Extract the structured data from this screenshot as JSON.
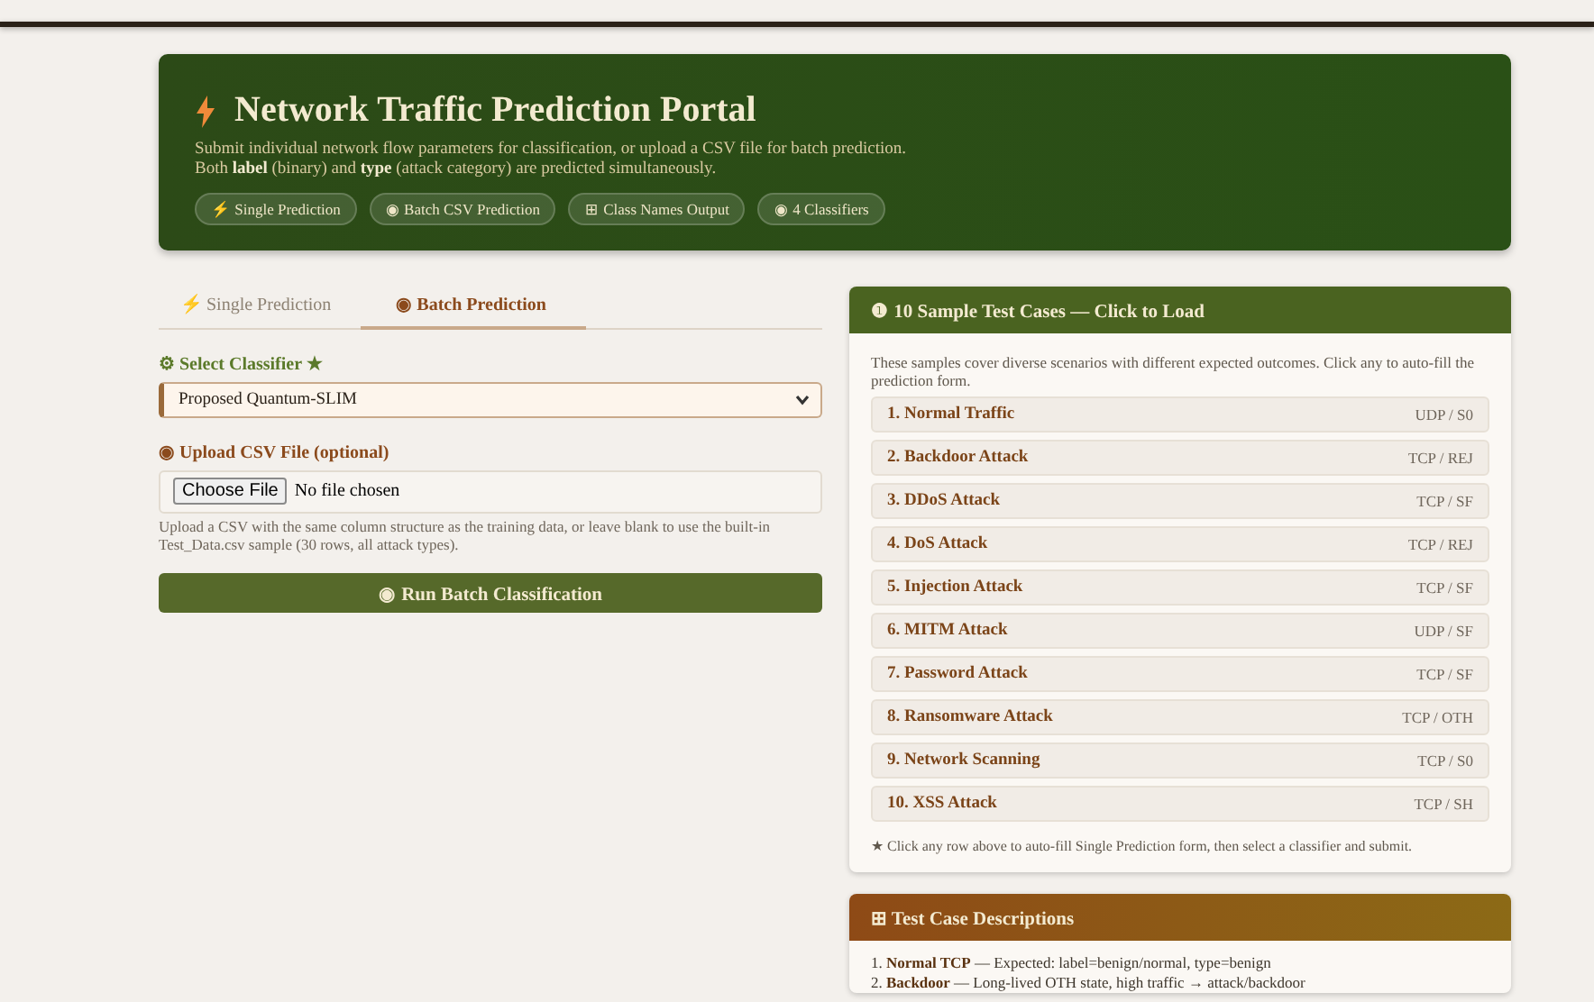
{
  "header": {
    "title": "Network Traffic Prediction Portal",
    "subtitle": "Submit individual network flow parameters for classification, or upload a CSV file for batch prediction.",
    "subtitle_2": "Both **label** (binary) and **type** (attack category) are predicted simultaneously.",
    "chips": [
      {
        "label": "⚡ Single Prediction"
      },
      {
        "label": "◉ Batch CSV Prediction"
      },
      {
        "label": "⊞ Class Names Output"
      },
      {
        "label": "◉ 4 Classifiers"
      }
    ]
  },
  "tabs": [
    {
      "label": "⚡ Single Prediction",
      "selected": false
    },
    {
      "label": "◉ Batch Prediction",
      "selected": true
    }
  ],
  "form": {
    "classifier_label": "⚙ Select Classifier ★",
    "classifier_value": "Proposed Quantum-SLIM",
    "upload_label": "◉ Upload CSV File (optional)",
    "file_button": "Choose File",
    "file_status": "No file chosen",
    "help": "Upload a CSV with the same column structure as the training data, or leave blank to use the built-in Test_Data.csv sample (30 rows, all attack types).",
    "run_button": "◉ Run Batch Classification"
  },
  "samples": {
    "title": "❶ 10 Sample Test Cases — Click to Load",
    "intro": "These samples cover diverse scenarios with different expected outcomes. Click any to auto-fill the prediction form.",
    "cases": [
      {
        "name": "1. Normal Traffic",
        "proto": "UDP / S0"
      },
      {
        "name": "2. Backdoor Attack",
        "proto": "TCP / REJ"
      },
      {
        "name": "3. DDoS Attack",
        "proto": "TCP / SF"
      },
      {
        "name": "4. DoS Attack",
        "proto": "TCP / REJ"
      },
      {
        "name": "5. Injection Attack",
        "proto": "TCP / SF"
      },
      {
        "name": "6. MITM Attack",
        "proto": "UDP / SF"
      },
      {
        "name": "7. Password Attack",
        "proto": "TCP / SF"
      },
      {
        "name": "8. Ransomware Attack",
        "proto": "TCP / OTH"
      },
      {
        "name": "9. Network Scanning",
        "proto": "TCP / S0"
      },
      {
        "name": "10. XSS Attack",
        "proto": "TCP / SH"
      }
    ],
    "note": "★ Click any row above to auto-fill Single Prediction form, then select a classifier and submit."
  },
  "descriptions": {
    "title": "⊞ Test Case Descriptions",
    "lines": [
      "1. **Normal TCP** — Expected: label=benign/normal, type=benign",
      "2. **Backdoor** — Long-lived OTH state, high traffic → attack/backdoor"
    ]
  }
}
